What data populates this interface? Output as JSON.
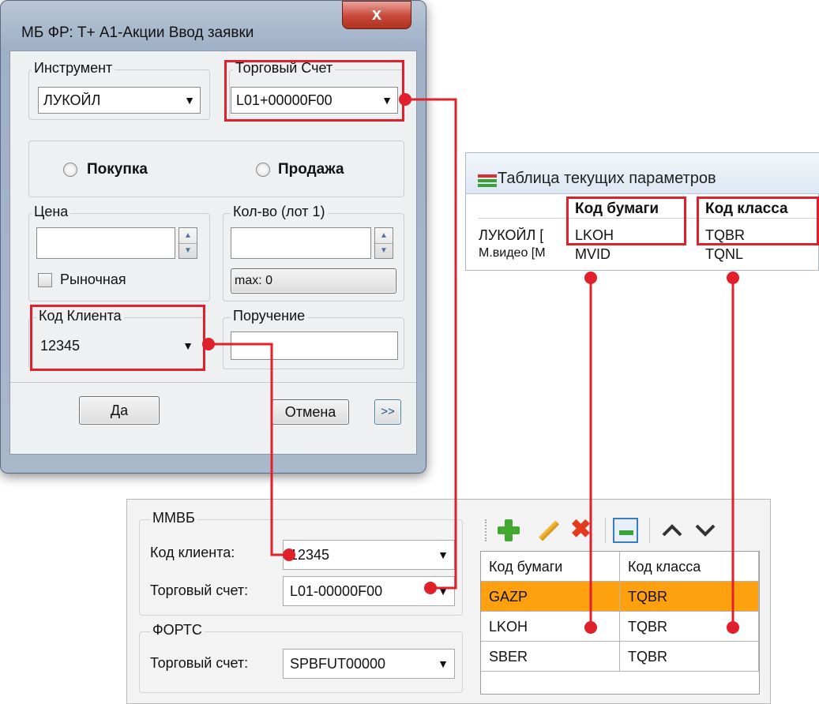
{
  "dialog": {
    "title": "МБ ФР: Т+ А1-Акции Ввод заявки",
    "close_label": "x",
    "instrument": {
      "label": "Инструмент",
      "value": "ЛУКОЙЛ"
    },
    "account": {
      "label": "Торговый Счет",
      "value": "L01+00000F00"
    },
    "buy_label": "Покупка",
    "sell_label": "Продажа",
    "price_label": "Цена",
    "qty_label": "Кол-во (лот 1)",
    "market_label": "Рыночная",
    "max_label": "max: 0",
    "client_code": {
      "label": "Код Клиента",
      "value": "12345"
    },
    "order_label": "Поручение",
    "ok_label": "Да",
    "cancel_label": "Отмена",
    "more_label": ">>"
  },
  "params_table": {
    "title": "Таблица текущих параметров",
    "headers": [
      "Код бумаги",
      "Код класса"
    ],
    "rows": [
      {
        "name": "ЛУКОЙЛ [",
        "code": "LKOH",
        "class": "TQBR"
      },
      {
        "name": "М.видео [М",
        "code": "MVID",
        "class": "TQNL"
      }
    ]
  },
  "settings": {
    "mmvb": {
      "label": "ММВБ",
      "client_label": "Код клиента:",
      "client_value": "12345",
      "account_label": "Торговый счет:",
      "account_value": "L01-00000F00"
    },
    "forts": {
      "label": "ФОРТС",
      "account_label": "Торговый счет:",
      "account_value": "SPBFUT00000"
    },
    "grid": {
      "headers": [
        "Код бумаги",
        "Код класса"
      ],
      "rows": [
        {
          "code": "GAZP",
          "class": "TQBR"
        },
        {
          "code": "LKOH",
          "class": "TQBR"
        },
        {
          "code": "SBER",
          "class": "TQBR"
        }
      ]
    }
  },
  "colors": {
    "highlight": "#e0202a",
    "selected_row": "#ffa00f"
  }
}
